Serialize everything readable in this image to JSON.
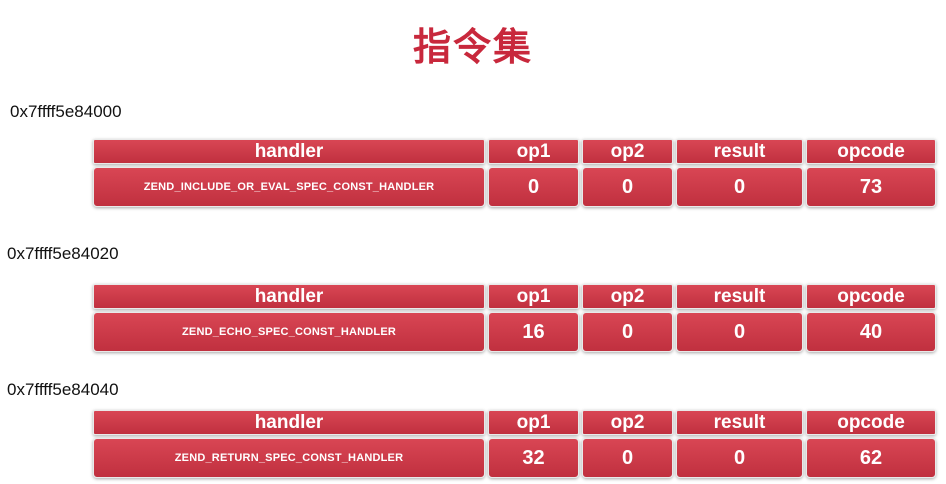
{
  "title": "指令集",
  "headers": {
    "handler": "handler",
    "op1": "op1",
    "op2": "op2",
    "result": "result",
    "opcode": "opcode"
  },
  "instructions": [
    {
      "address": "0x7ffff5e84000",
      "handler": "ZEND_INCLUDE_OR_EVAL_SPEC_CONST_HANDLER",
      "op1": "0",
      "op2": "0",
      "result": "0",
      "opcode": "73"
    },
    {
      "address": "0x7ffff5e84020",
      "handler": "ZEND_ECHO_SPEC_CONST_HANDLER",
      "op1": "16",
      "op2": "0",
      "result": "0",
      "opcode": "40"
    },
    {
      "address": "0x7ffff5e84040",
      "handler": "ZEND_RETURN_SPEC_CONST_HANDLER",
      "op1": "32",
      "op2": "0",
      "result": "0",
      "opcode": "62"
    }
  ]
}
